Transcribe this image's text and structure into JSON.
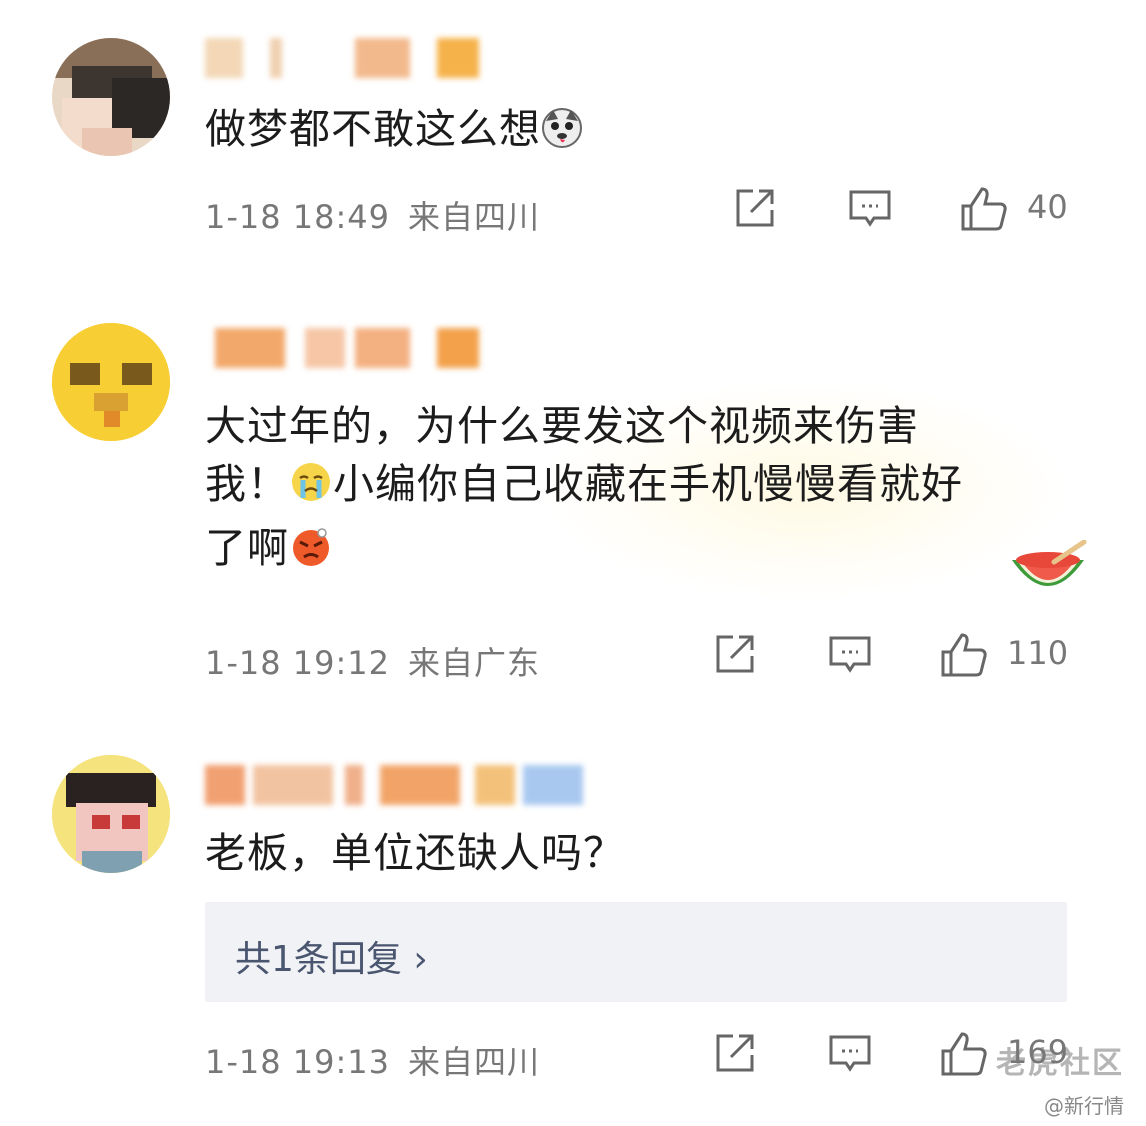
{
  "comments": [
    {
      "text": "做梦都不敢这么想",
      "time": "1-18 18:49",
      "location": "来自四川",
      "likes": "40"
    },
    {
      "text_line1": "大过年的，为什么要发这个视频来伤害",
      "text_line2a": "我！",
      "text_line2b": "小编你自己收藏在手机慢慢看就好",
      "text_line3": "了啊",
      "time": "1-18 19:12",
      "location": "来自广东",
      "likes": "110"
    },
    {
      "text": "老板，单位还缺人吗？",
      "reply_summary": "共1条回复 ›",
      "time": "1-18 19:13",
      "location": "来自四川",
      "likes": "169"
    }
  ],
  "watermark": {
    "main": "老虎社区",
    "sub": "@新行情"
  },
  "icons": [
    "share-icon",
    "comment-icon",
    "like-icon"
  ],
  "colors": {
    "meta_text": "#777777",
    "reply_bg": "#f1f2f5",
    "reply_text": "#4a5570"
  }
}
